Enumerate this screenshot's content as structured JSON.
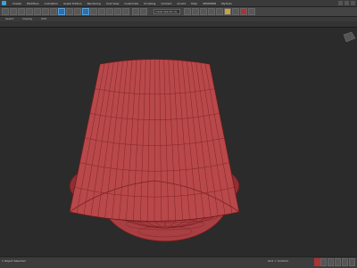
{
  "menubar": {
    "items": [
      "Create",
      "Modifiers",
      "Animation",
      "Graph Editors",
      "Rendering",
      "Civil View",
      "Customize",
      "Scripting",
      "Content",
      "Arnold",
      "Help",
      "3DSPIDER",
      "MyTools"
    ]
  },
  "toolbar": {
    "selection_dropdown": "Create Selection Se"
  },
  "ribbon": {
    "tabs": [
      "Select",
      "Display",
      "Edit"
    ]
  },
  "viewport": {
    "label": "[+] [Perspective] [Standard] [Edged Faces]",
    "model": "lampshade-mesh",
    "model_color": "#b8484a",
    "wire_color": "#7a1f20",
    "background": "#2b2b2b"
  },
  "statusbar": {
    "left": "1 Object Selected",
    "middle": "Add Time Tag",
    "grid": "Grid = 10.0mm"
  }
}
